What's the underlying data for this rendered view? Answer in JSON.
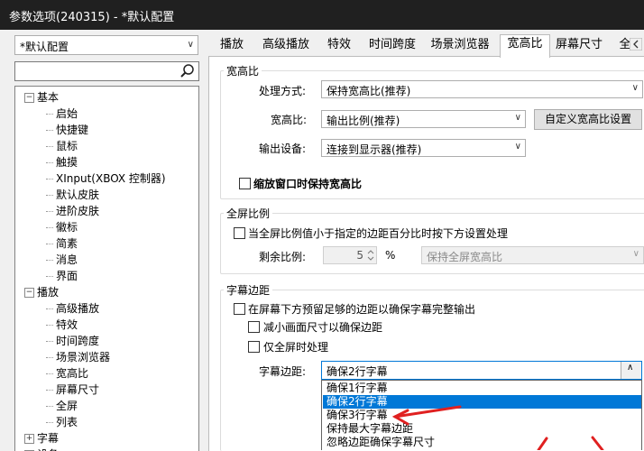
{
  "window": {
    "title": "参数选项(240315) - *默认配置"
  },
  "profile": {
    "selected": "*默认配置"
  },
  "search": {
    "value": ""
  },
  "tree": {
    "basic": {
      "label": "基本",
      "children": [
        "启始",
        "快捷键",
        "鼠标",
        "触摸",
        "XInput(XBOX 控制器)",
        "默认皮肤",
        "进阶皮肤",
        "徽标",
        "简素",
        "消息",
        "界面"
      ]
    },
    "playback": {
      "label": "播放",
      "children": [
        "高级播放",
        "特效",
        "时间跨度",
        "场景浏览器",
        "宽高比",
        "屏幕尺寸",
        "全屏",
        "列表"
      ]
    },
    "subtitle": {
      "label": "字幕"
    },
    "more": {
      "label": "设备"
    }
  },
  "tabs": [
    "播放",
    "高级播放",
    "特效",
    "时间跨度",
    "场景浏览器",
    "宽高比",
    "屏幕尺寸",
    "全"
  ],
  "aspect_group": {
    "title": "宽高比",
    "method_label": "处理方式:",
    "method_value": "保持宽高比(推荐)",
    "ratio_label": "宽高比:",
    "ratio_value": "输出比例(推荐)",
    "custom_button": "自定义宽高比设置",
    "output_label": "输出设备:",
    "output_value": "连接到显示器(推荐)",
    "keep_on_resize": "缩放窗口时保持宽高比"
  },
  "fullscreen_group": {
    "title": "全屏比例",
    "use_below": "当全屏比例值小于指定的边距百分比时按下方设置处理",
    "remain_label": "剩余比例:",
    "remain_value": "5",
    "remain_unit": "%",
    "remain_mode": "保持全屏宽高比"
  },
  "subtitle_group": {
    "title": "字幕边距",
    "reserve_margin": "在屏幕下方预留足够的边距以确保字幕完整输出",
    "shrink": "减小画面尺寸以确保边距",
    "fullscreen_only": "仅全屏时处理",
    "margin_label": "字幕边距:",
    "margin_value": "确保2行字幕",
    "options": [
      "确保1行字幕",
      "确保2行字幕",
      "确保3行字幕",
      "保持最大字幕边距",
      "忽略边距确保字幕尺寸"
    ],
    "selected_index": 1
  },
  "colors": {
    "accent": "#0078d7",
    "arrow": "#e02020",
    "titlebar": "#202020"
  }
}
